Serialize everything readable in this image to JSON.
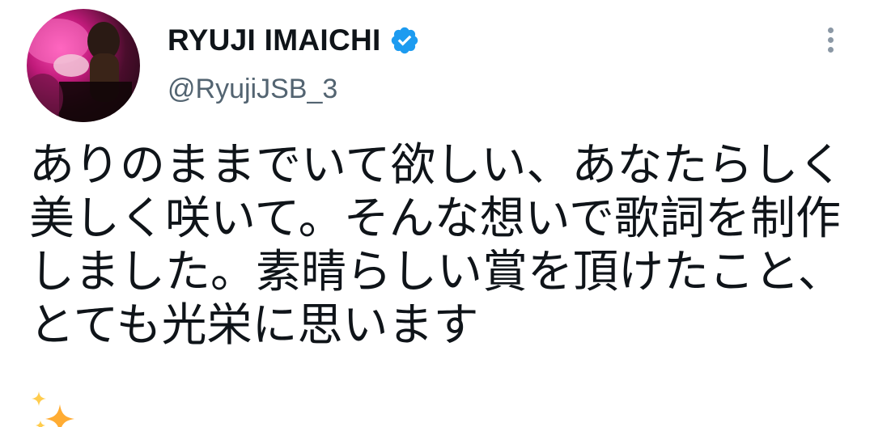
{
  "author": {
    "display_name": "RYUJI IMAICHI",
    "handle": "@RyujiJSB_3",
    "verified": true
  },
  "tweet": {
    "text": "ありのままでいて欲しい、あなたらしく美しく咲いて。そんな想いで歌詞を制作しました。素晴らしい賞を頂けたこと、とても光栄に思います",
    "emoji": "sparkles-icon"
  },
  "colors": {
    "verified_badge": "#1d9bf0",
    "handle": "#536471",
    "text": "#0f1419",
    "more_dots": "#8b98a5",
    "sparkle": "#ffac33"
  }
}
